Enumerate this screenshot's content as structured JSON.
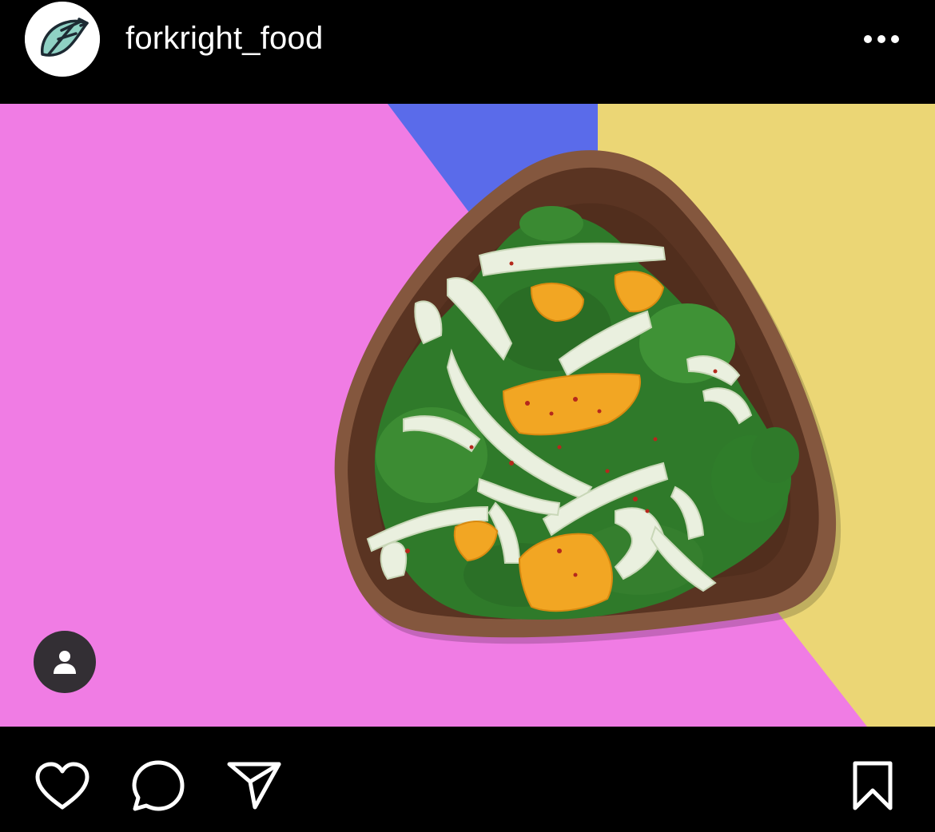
{
  "post": {
    "username": "forkright_food",
    "avatar_icon": "fork-leaf-logo",
    "avatar_bg": "#ffffff",
    "logo_fill": "#8fd1c4",
    "logo_stroke": "#1d2a33",
    "menu_icon": "more-horizontal-icon"
  },
  "photo": {
    "subject_icon": "salad-bowl-photo",
    "colors": {
      "pink": "#f07ce4",
      "blue": "#5a6bea",
      "yellow": "#ebd675",
      "bowl": "#5a3422",
      "bowl_rim": "#84573e",
      "kale": "#2f7a2a",
      "fennel": "#eaf0df",
      "orange": "#f2a623"
    },
    "tag_icon": "user-tag-icon"
  },
  "actions": {
    "like_icon": "heart-icon",
    "comment_icon": "comment-icon",
    "share_icon": "send-icon",
    "save_icon": "bookmark-icon"
  }
}
